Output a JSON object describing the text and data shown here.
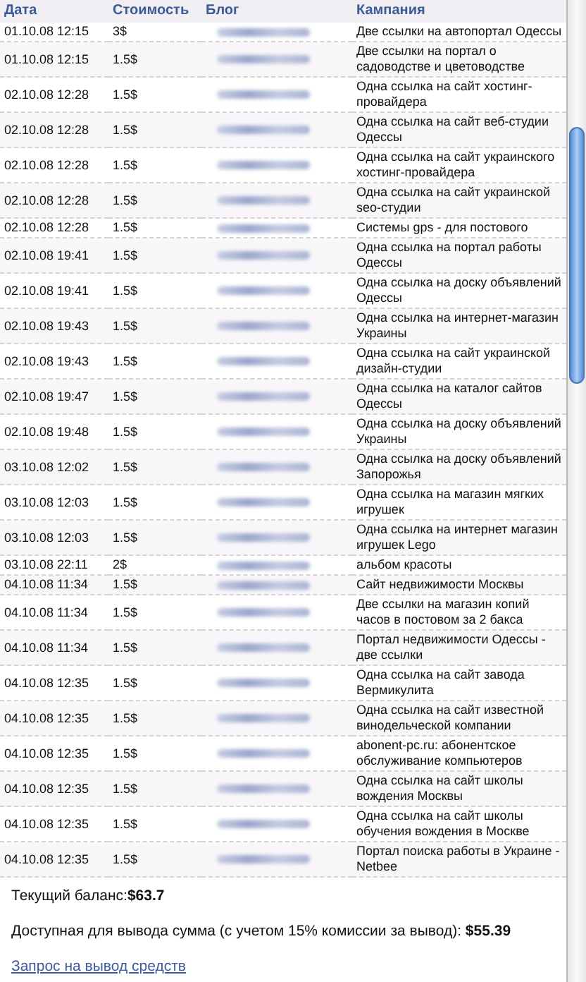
{
  "table": {
    "columns": [
      "Дата",
      "Стоимость",
      "Блог",
      "Кампания"
    ],
    "rows": [
      {
        "date": "01.10.08 12:15",
        "cost": "3$",
        "campaign": "Две ссылки на автопортал Одессы"
      },
      {
        "date": "01.10.08 12:15",
        "cost": "1.5$",
        "campaign": "Две ссылки на портал о садоводстве и цветоводстве"
      },
      {
        "date": "02.10.08 12:28",
        "cost": "1.5$",
        "campaign": "Одна ссылка на сайт хостинг-провайдера"
      },
      {
        "date": "02.10.08 12:28",
        "cost": "1.5$",
        "campaign": "Одна ссылка на сайт веб-студии Одессы"
      },
      {
        "date": "02.10.08 12:28",
        "cost": "1.5$",
        "campaign": "Одна ссылка на сайт украинского хостинг-провайдера"
      },
      {
        "date": "02.10.08 12:28",
        "cost": "1.5$",
        "campaign": "Одна ссылка на сайт украинской seo-студии"
      },
      {
        "date": "02.10.08 12:28",
        "cost": "1.5$",
        "campaign": "Системы gps - для постового"
      },
      {
        "date": "02.10.08 19:41",
        "cost": "1.5$",
        "campaign": "Одна ссылка на портал работы Одессы"
      },
      {
        "date": "02.10.08 19:41",
        "cost": "1.5$",
        "campaign": "Одна ссылка на доску объявлений Одессы"
      },
      {
        "date": "02.10.08 19:43",
        "cost": "1.5$",
        "campaign": "Одна ссылка на интернет-магазин Украины"
      },
      {
        "date": "02.10.08 19:43",
        "cost": "1.5$",
        "campaign": "Одна ссылка на сайт украинской дизайн-студии"
      },
      {
        "date": "02.10.08 19:47",
        "cost": "1.5$",
        "campaign": "Одна ссылка на каталог сайтов Одессы"
      },
      {
        "date": "02.10.08 19:48",
        "cost": "1.5$",
        "campaign": "Одна ссылка на доску объявлений Украины"
      },
      {
        "date": "03.10.08 12:02",
        "cost": "1.5$",
        "campaign": "Одна ссылка на доску объявлений Запорожья"
      },
      {
        "date": "03.10.08 12:03",
        "cost": "1.5$",
        "campaign": "Одна ссылка на магазин мягких игрушек"
      },
      {
        "date": "03.10.08 12:03",
        "cost": "1.5$",
        "campaign": "Одна ссылка на интернет магазин игрушек Lego"
      },
      {
        "date": "03.10.08 22:11",
        "cost": "2$",
        "campaign": "альбом красоты"
      },
      {
        "date": "04.10.08 11:34",
        "cost": "1.5$",
        "campaign": "Сайт недвижимости Москвы"
      },
      {
        "date": "04.10.08 11:34",
        "cost": "1.5$",
        "campaign": "Две ссылки на магазин копий часов в постовом за 2 бакса"
      },
      {
        "date": "04.10.08 11:34",
        "cost": "1.5$",
        "campaign": "Портал недвижимости Одессы - две ссылки"
      },
      {
        "date": "04.10.08 12:35",
        "cost": "1.5$",
        "campaign": "Одна ссылка на сайт завода Вермикулита"
      },
      {
        "date": "04.10.08 12:35",
        "cost": "1.5$",
        "campaign": "Одна ссылка на сайт известной винодельческой компании"
      },
      {
        "date": "04.10.08 12:35",
        "cost": "1.5$",
        "campaign": "abonent-pc.ru: абонентское обслуживание компьютеров"
      },
      {
        "date": "04.10.08 12:35",
        "cost": "1.5$",
        "campaign": "Одна ссылка на сайт школы вождения Москвы"
      },
      {
        "date": "04.10.08 12:35",
        "cost": "1.5$",
        "campaign": "Одна ссылка на сайт школы обучения вождения в Москве"
      },
      {
        "date": "04.10.08 12:35",
        "cost": "1.5$",
        "campaign": "Портал поиска работы в Украине - Netbee"
      }
    ]
  },
  "balance": "Текущий баланс:**$63.7**",
  "available": "Доступная для вывода сумма (с учетом 15% комиссии за вывод): **$55.39**",
  "withdraw_link": "Запрос на вывод средств"
}
